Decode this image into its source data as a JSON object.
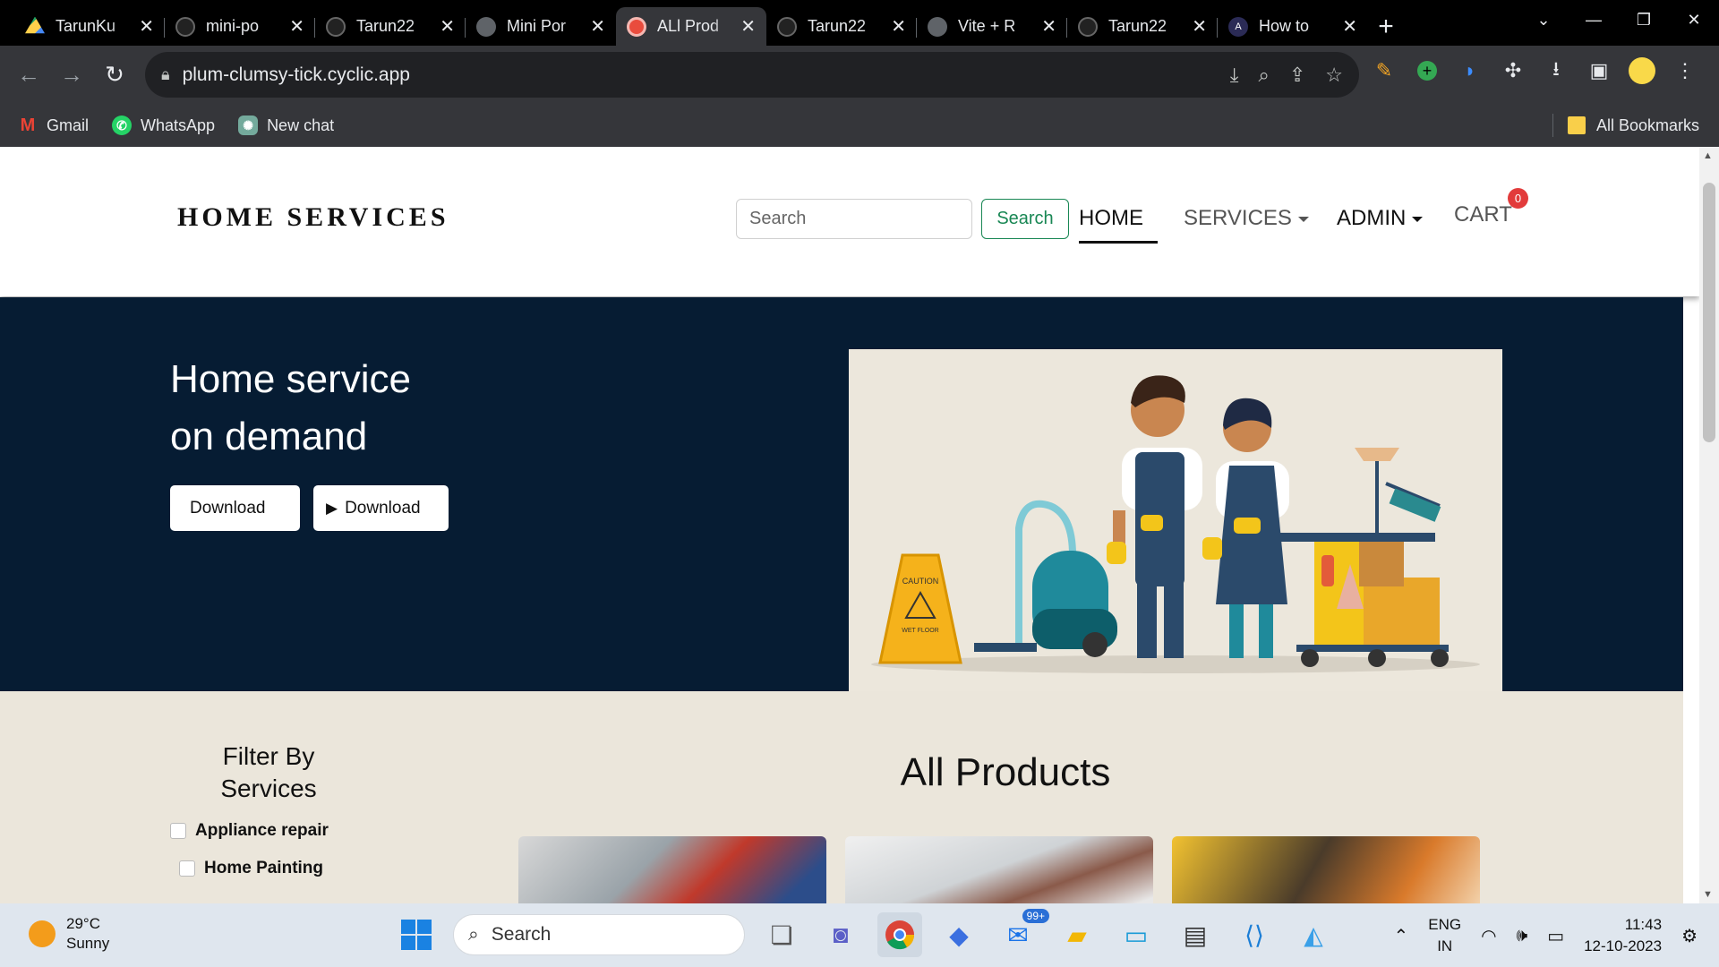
{
  "browser": {
    "tabs": [
      {
        "title": "TarunKu",
        "icon": "google-drive-icon",
        "active": false
      },
      {
        "title": "mini-po",
        "icon": "github-icon",
        "active": false
      },
      {
        "title": "Tarun22",
        "icon": "github-icon",
        "active": false
      },
      {
        "title": "Mini Por",
        "icon": "globe-icon",
        "active": false
      },
      {
        "title": "ALl Prod",
        "icon": "site-favicon",
        "active": true
      },
      {
        "title": "Tarun22",
        "icon": "github-icon",
        "active": false
      },
      {
        "title": "Vite + R",
        "icon": "globe-icon",
        "active": false
      },
      {
        "title": "Tarun22",
        "icon": "github-icon",
        "active": false
      },
      {
        "title": "How to",
        "icon": "devto-icon",
        "active": false
      }
    ],
    "url": "plum-clumsy-tick.cyclic.app",
    "bookmarks": [
      {
        "label": "Gmail",
        "icon": "gmail-icon"
      },
      {
        "label": "WhatsApp",
        "icon": "whatsapp-icon"
      },
      {
        "label": "New chat",
        "icon": "chatgpt-icon"
      }
    ],
    "all_bookmarks_label": "All Bookmarks"
  },
  "site": {
    "brand": "HOME SERVICES",
    "search_placeholder": "Search",
    "search_button": "Search",
    "nav": {
      "home": "HOME",
      "services": "SERVICES",
      "admin": "ADMIN",
      "cart": "CART",
      "cart_count": "0"
    },
    "hero": {
      "title_line1": "Home service",
      "title_line2": "on demand",
      "download_apple": "Download",
      "download_play": "Download",
      "caution_sign": "CAUTION",
      "wet_floor": "WET FLOOR"
    },
    "filter": {
      "title_line1": "Filter By",
      "title_line2": "Services",
      "options": [
        "Appliance repair",
        "Home Painting"
      ]
    },
    "products_title": "All Products"
  },
  "taskbar": {
    "weather_temp": "29°C",
    "weather_desc": "Sunny",
    "search_placeholder": "Search",
    "mail_badge": "99+",
    "lang_line1": "ENG",
    "lang_line2": "IN",
    "time": "11:43",
    "date": "12-10-2023"
  },
  "colors": {
    "hero_bg": "#061c33",
    "content_bg": "#ebe6db",
    "search_button_border": "#198754",
    "cart_badge": "#e23b3b"
  }
}
